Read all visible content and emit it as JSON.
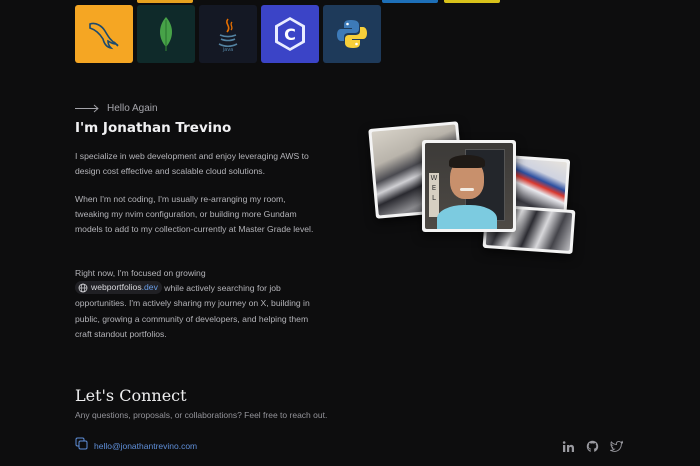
{
  "theme": {
    "background": "#0d0d0e",
    "accent_link": "#5f8fd9",
    "heading": "#f1f1f3"
  },
  "skills": [
    {
      "name": "mysql",
      "icon": "mysql-dolphin-icon",
      "bg": "#f5a623"
    },
    {
      "name": "mongodb",
      "icon": "mongodb-leaf-icon",
      "bg": "#0f2a2a"
    },
    {
      "name": "java",
      "icon": "java-cup-icon",
      "bg": "#141824"
    },
    {
      "name": "c",
      "icon": "c-language-icon",
      "bg": "#3b44c7"
    },
    {
      "name": "python",
      "icon": "python-icon",
      "bg": "#1e3a5a"
    }
  ],
  "intro": {
    "eyebrow": "Hello Again",
    "name": "I'm Jonathan Trevino",
    "p1": "I specialize in web development and enjoy leveraging AWS to design cost effective and scalable cloud solutions.",
    "p2": "When I'm not coding, I'm usually re-arranging my room, tweaking my nvim configuration, or building more Gundam models to add to my collection-currently at Master Grade level.",
    "p3_before": "Right now, I'm focused on growing",
    "chip_domain": "webportfolios",
    "chip_tld": ".dev",
    "p3_after": "while actively searching for job opportunities. I'm actively sharing my journey on X, building in public, growing a community of developers, and helping them craft standout portfolios."
  },
  "connect": {
    "title": "Let's Connect",
    "subtitle": "Any questions, proposals, or collaborations? Feel free to reach out.",
    "email": "hello@jonathantrevino.com"
  },
  "socials": [
    {
      "name": "linkedin",
      "icon": "linkedin-icon"
    },
    {
      "name": "github",
      "icon": "github-icon"
    },
    {
      "name": "twitter",
      "icon": "twitter-icon"
    }
  ]
}
